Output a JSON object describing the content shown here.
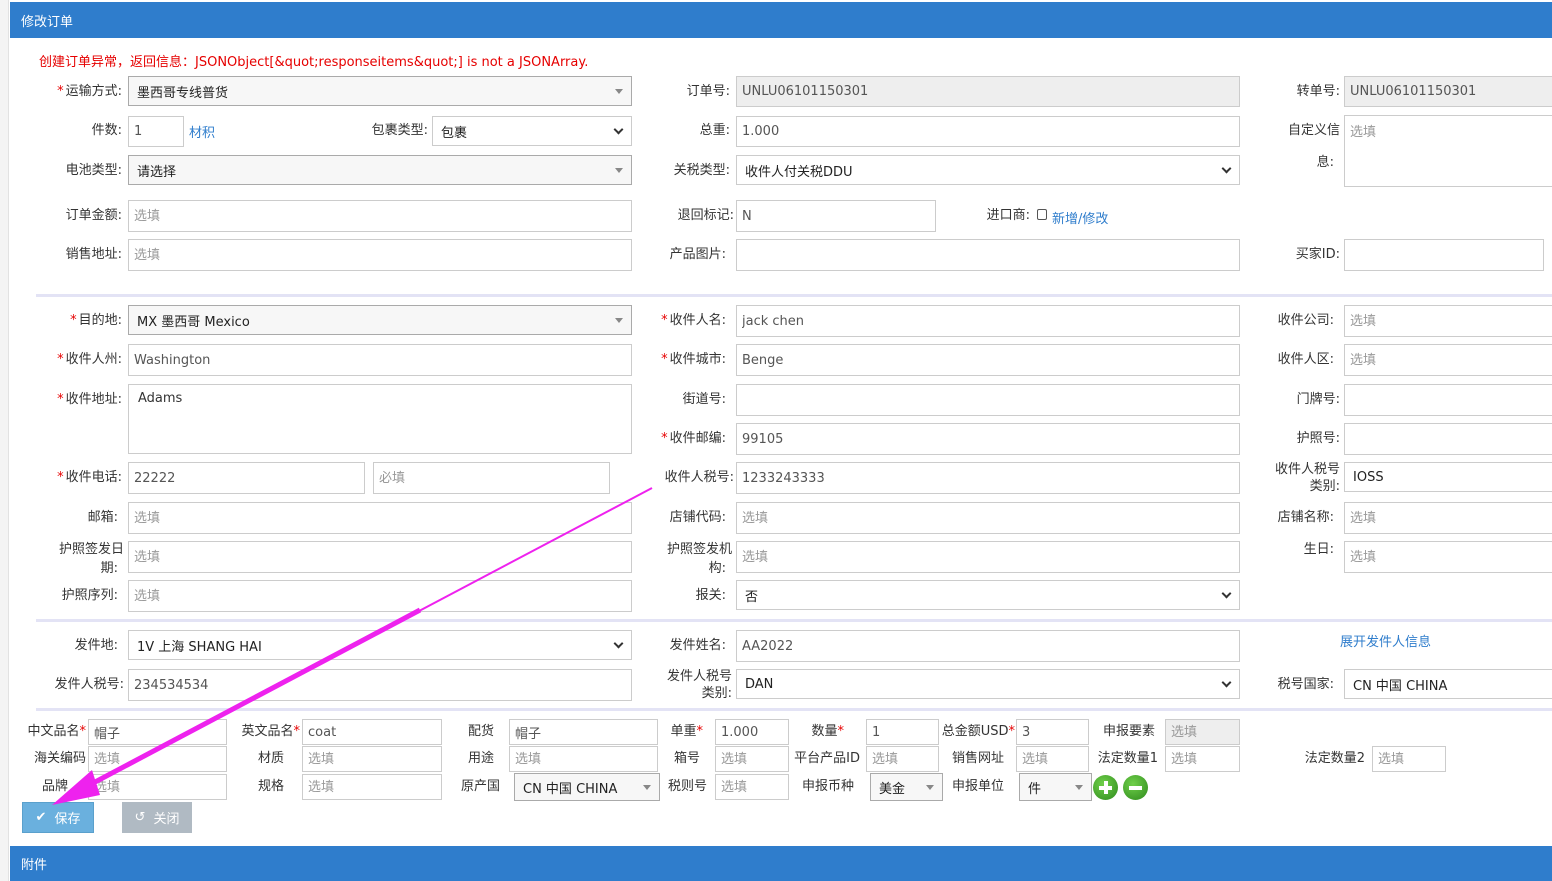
{
  "header": {
    "title": "修改订单"
  },
  "error": "创建订单异常，返回信息：JSONObject[&quot;responseitems&quot;] is not a JSONArray.",
  "ph": {
    "optional": "选填",
    "required": "必填"
  },
  "s1": {
    "shipping_method": {
      "label": "运输方式:",
      "value": "墨西哥专线普货"
    },
    "pieces": {
      "label": "件数:",
      "value": "1",
      "link": "材积"
    },
    "package_type": {
      "label": "包裹类型:",
      "value": "包裹"
    },
    "battery_type": {
      "label": "电池类型:",
      "value": "请选择"
    },
    "order_amount": {
      "label": "订单金额:"
    },
    "sales_address": {
      "label": "销售地址:"
    },
    "order_no": {
      "label": "订单号:",
      "value": "UNLU06101150301"
    },
    "gross_weight": {
      "label": "总重:",
      "value": "1.000"
    },
    "duty_type": {
      "label": "关税类型:",
      "value": "收件人付关税DDU"
    },
    "return_flag": {
      "label": "退回标记:",
      "value": "N"
    },
    "importer": {
      "label": "进口商:",
      "link": "新增/修改"
    },
    "product_image": {
      "label": "产品图片:"
    },
    "transfer_no": {
      "label": "转单号:",
      "value": "UNLU06101150301"
    },
    "custom_info": {
      "label1": "自定义信",
      "label2": "息:"
    },
    "buyer_id": {
      "label": "买家ID:"
    }
  },
  "s2": {
    "destination": {
      "label": "目的地:",
      "value": "MX 墨西哥 Mexico"
    },
    "state": {
      "label": "收件人州:",
      "value": "Washington"
    },
    "address": {
      "label": "收件地址:",
      "value": "Adams"
    },
    "phone": {
      "label": "收件电话:",
      "value": "22222"
    },
    "email": {
      "label": "邮箱:"
    },
    "passport_date": {
      "label1": "护照签发日",
      "label2": "期:"
    },
    "passport_serial": {
      "label": "护照序列:"
    },
    "name": {
      "label": "收件人名:",
      "value": "jack chen"
    },
    "city": {
      "label": "收件城市:",
      "value": "Benge"
    },
    "street_no": {
      "label": "街道号:"
    },
    "postcode": {
      "label": "收件邮编:",
      "value": "99105"
    },
    "tax_no": {
      "label": "收件人税号:",
      "value": "1233243333"
    },
    "shop_code": {
      "label": "店铺代码:"
    },
    "passport_authority": {
      "label1": "护照签发机",
      "label2": "构:"
    },
    "customs": {
      "label": "报关:",
      "value": "否"
    },
    "company": {
      "label": "收件公司:"
    },
    "district": {
      "label": "收件人区:"
    },
    "door_no": {
      "label": "门牌号:"
    },
    "passport_no": {
      "label": "护照号:"
    },
    "tax_type": {
      "label1": "收件人税号",
      "label2": "类别:",
      "value": "IOSS"
    },
    "shop_name": {
      "label": "店铺名称:"
    },
    "birthday": {
      "label": "生日:"
    }
  },
  "s3": {
    "origin": {
      "label": "发件地:",
      "value": "1V 上海 SHANG HAI"
    },
    "sender_tax": {
      "label": "发件人税号:",
      "value": "234534534"
    },
    "sender_name": {
      "label": "发件姓名:",
      "value": "AA2022"
    },
    "sender_tax_type": {
      "label1": "发件人税号",
      "label2": "类别:",
      "value": "DAN"
    },
    "expand_link": "展开发件人信息",
    "tax_country": {
      "label": "税号国家:",
      "value": "CN 中国 CHINA"
    }
  },
  "product": {
    "cn_name": {
      "label": "中文品名",
      "value": "帽子"
    },
    "en_name": {
      "label": "英文品名",
      "value": "coat"
    },
    "allocation": {
      "label": "配货",
      "value": "帽子"
    },
    "unit_weight": {
      "label": "单重",
      "value": "1.000"
    },
    "quantity": {
      "label": "数量",
      "value": "1"
    },
    "total_usd": {
      "label": "总金额USD",
      "value": "3"
    },
    "elements": {
      "label": "申报要素"
    },
    "hs_code": {
      "label": "海关编码"
    },
    "material": {
      "label": "材质"
    },
    "usage": {
      "label": "用途"
    },
    "box_no": {
      "label": "箱号"
    },
    "platform_id": {
      "label": "平台产品ID"
    },
    "sales_url": {
      "label": "销售网址"
    },
    "legal_qty1": {
      "label": "法定数量1"
    },
    "legal_qty2": {
      "label": "法定数量2"
    },
    "brand": {
      "label": "品牌"
    },
    "spec": {
      "label": "规格"
    },
    "country": {
      "label": "原产国",
      "value": "CN 中国 CHINA"
    },
    "tariff_no": {
      "label": "税则号"
    },
    "currency": {
      "label": "申报币种",
      "value": "美金"
    },
    "unit": {
      "label": "申报单位",
      "value": "件"
    }
  },
  "buttons": {
    "save": "保存",
    "close": "关闭"
  },
  "footer": {
    "title": "附件"
  },
  "asterisk": "*",
  "colors": {
    "primary": "#2f7dcc",
    "error": "#e60000",
    "save": "#6ab0de",
    "close": "#b0bac3",
    "arrow": "#ee22ee"
  }
}
